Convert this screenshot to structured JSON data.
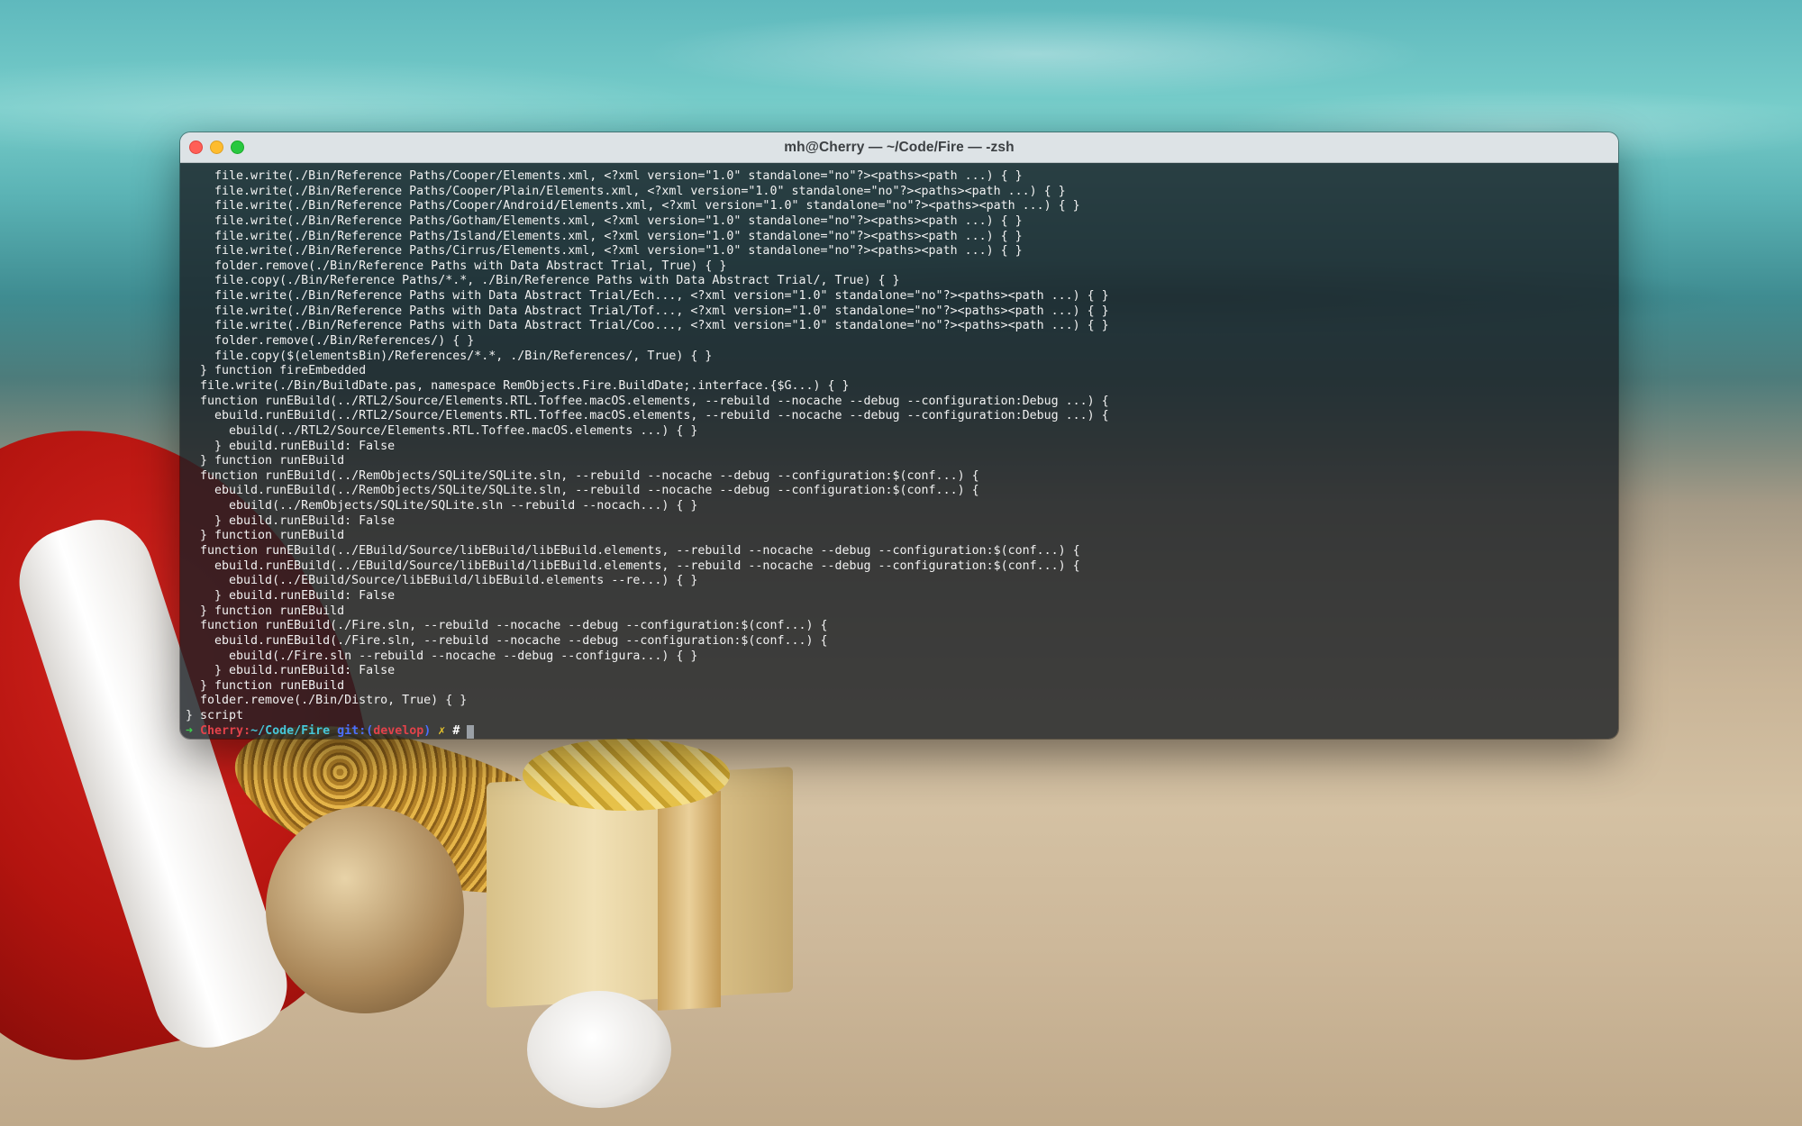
{
  "window": {
    "title": "mh@Cherry — ~/Code/Fire — -zsh"
  },
  "terminal": {
    "lines": [
      "    file.write(./Bin/Reference Paths/Cooper/Elements.xml, <?xml version=\"1.0\" standalone=\"no\"?><paths><path ...) { }",
      "    file.write(./Bin/Reference Paths/Cooper/Plain/Elements.xml, <?xml version=\"1.0\" standalone=\"no\"?><paths><path ...) { }",
      "    file.write(./Bin/Reference Paths/Cooper/Android/Elements.xml, <?xml version=\"1.0\" standalone=\"no\"?><paths><path ...) { }",
      "    file.write(./Bin/Reference Paths/Gotham/Elements.xml, <?xml version=\"1.0\" standalone=\"no\"?><paths><path ...) { }",
      "    file.write(./Bin/Reference Paths/Island/Elements.xml, <?xml version=\"1.0\" standalone=\"no\"?><paths><path ...) { }",
      "    file.write(./Bin/Reference Paths/Cirrus/Elements.xml, <?xml version=\"1.0\" standalone=\"no\"?><paths><path ...) { }",
      "    folder.remove(./Bin/Reference Paths with Data Abstract Trial, True) { }",
      "    file.copy(./Bin/Reference Paths/*.*, ./Bin/Reference Paths with Data Abstract Trial/, True) { }",
      "    file.write(./Bin/Reference Paths with Data Abstract Trial/Ech..., <?xml version=\"1.0\" standalone=\"no\"?><paths><path ...) { }",
      "    file.write(./Bin/Reference Paths with Data Abstract Trial/Tof..., <?xml version=\"1.0\" standalone=\"no\"?><paths><path ...) { }",
      "    file.write(./Bin/Reference Paths with Data Abstract Trial/Coo..., <?xml version=\"1.0\" standalone=\"no\"?><paths><path ...) { }",
      "    folder.remove(./Bin/References/) { }",
      "    file.copy($(elementsBin)/References/*.*, ./Bin/References/, True) { }",
      "  } function fireEmbedded",
      "  file.write(./Bin/BuildDate.pas, namespace RemObjects.Fire.BuildDate;.interface.{$G...) { }",
      "  function runEBuild(../RTL2/Source/Elements.RTL.Toffee.macOS.elements, --rebuild --nocache --debug --configuration:Debug ...) {",
      "    ebuild.runEBuild(../RTL2/Source/Elements.RTL.Toffee.macOS.elements, --rebuild --nocache --debug --configuration:Debug ...) {",
      "      ebuild(../RTL2/Source/Elements.RTL.Toffee.macOS.elements ...) { }",
      "    } ebuild.runEBuild: False",
      "  } function runEBuild",
      "  function runEBuild(../RemObjects/SQLite/SQLite.sln, --rebuild --nocache --debug --configuration:$(conf...) {",
      "    ebuild.runEBuild(../RemObjects/SQLite/SQLite.sln, --rebuild --nocache --debug --configuration:$(conf...) {",
      "      ebuild(../RemObjects/SQLite/SQLite.sln --rebuild --nocach...) { }",
      "    } ebuild.runEBuild: False",
      "  } function runEBuild",
      "  function runEBuild(../EBuild/Source/libEBuild/libEBuild.elements, --rebuild --nocache --debug --configuration:$(conf...) {",
      "    ebuild.runEBuild(../EBuild/Source/libEBuild/libEBuild.elements, --rebuild --nocache --debug --configuration:$(conf...) {",
      "      ebuild(../EBuild/Source/libEBuild/libEBuild.elements --re...) { }",
      "    } ebuild.runEBuild: False",
      "  } function runEBuild",
      "  function runEBuild(./Fire.sln, --rebuild --nocache --debug --configuration:$(conf...) {",
      "    ebuild.runEBuild(./Fire.sln, --rebuild --nocache --debug --configuration:$(conf...) {",
      "      ebuild(./Fire.sln --rebuild --nocache --debug --configura...) { }",
      "    } ebuild.runEBuild: False",
      "  } function runEBuild",
      "  folder.remove(./Bin/Distro, True) { }",
      "} script"
    ],
    "prompt": {
      "arrow": "➜",
      "host": "Cherry",
      "colon": ":",
      "path": "~/Code/Fire",
      "git_label": "git:",
      "paren_open": "(",
      "branch": "develop",
      "paren_close": ")",
      "dirty_marker": "✗",
      "symbol": "#"
    }
  },
  "colors": {
    "terminal_bg": "#1a1f24",
    "prompt_arrow": "#3ecf4d",
    "prompt_host": "#e2424a",
    "prompt_path": "#46c6d8",
    "prompt_git": "#4c6fff",
    "prompt_dirty": "#e6c32c",
    "close": "#ff5f57",
    "minimize": "#febc2e",
    "zoom": "#28c840"
  }
}
